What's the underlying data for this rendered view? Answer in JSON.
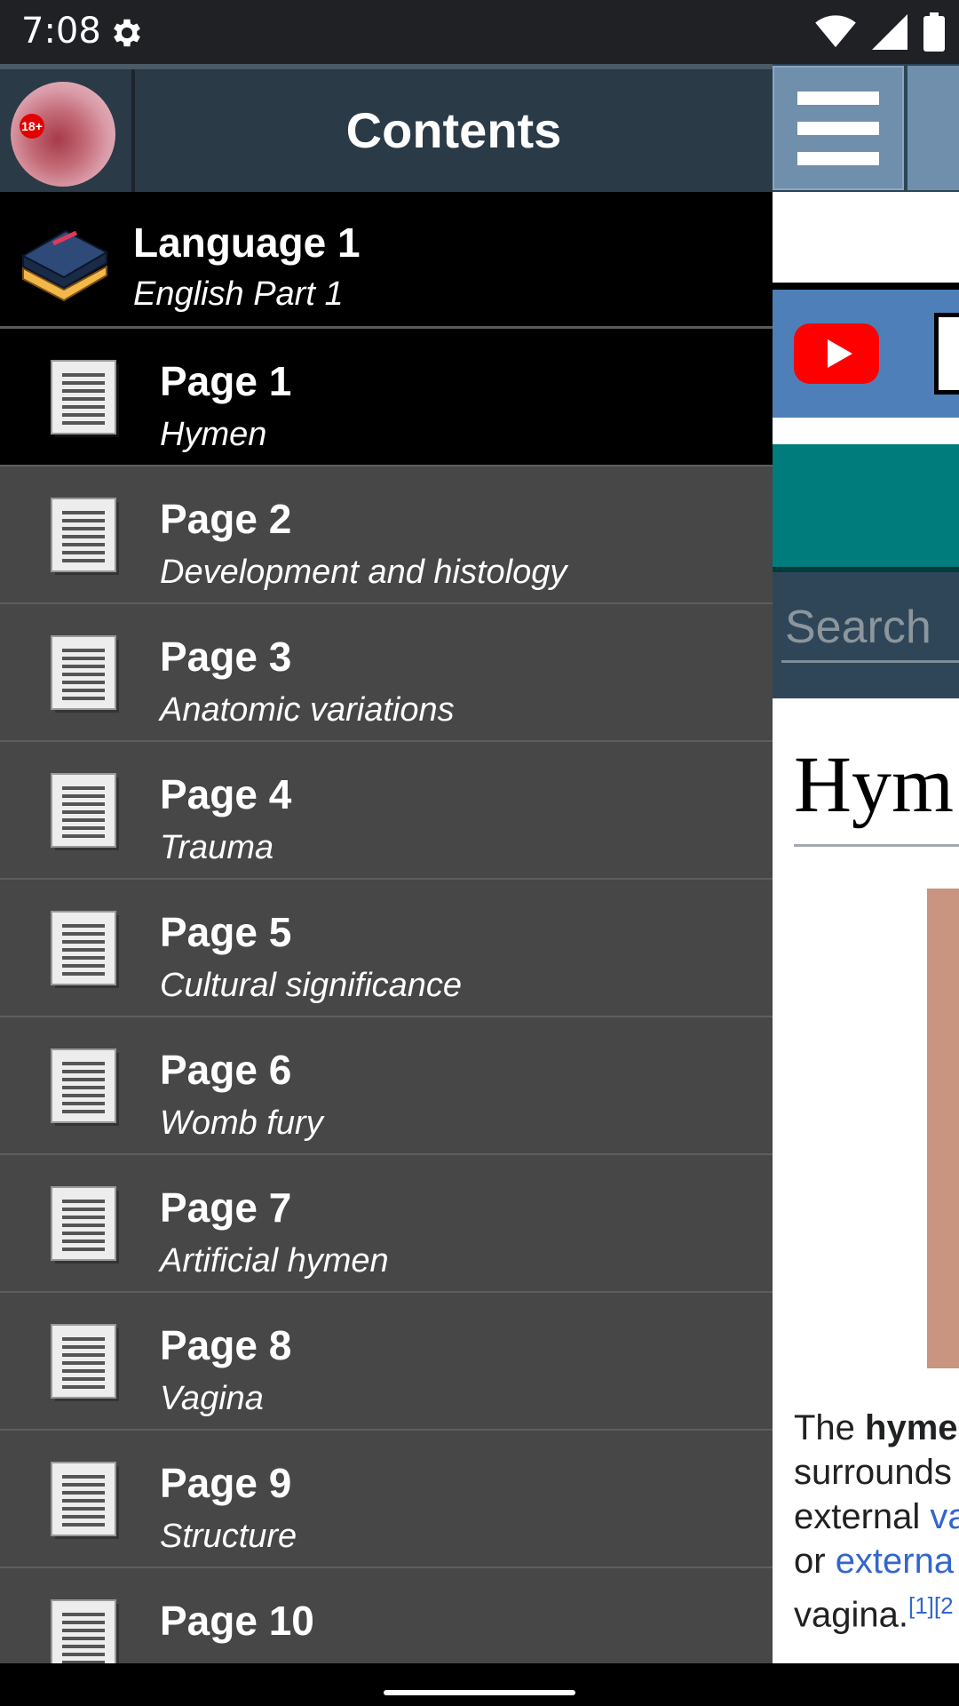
{
  "status_bar": {
    "time": "7:08",
    "icons": [
      "gear-icon",
      "wifi-icon",
      "signal-icon",
      "battery-icon"
    ]
  },
  "drawer": {
    "title": "Contents",
    "avatar_badge": "18+",
    "section": {
      "title": "Language 1",
      "subtitle": "English Part 1",
      "icon": "book-stack-icon"
    },
    "pages": [
      {
        "title": "Page 1",
        "subtitle": "Hymen"
      },
      {
        "title": "Page 2",
        "subtitle": "Development and histology"
      },
      {
        "title": "Page 3",
        "subtitle": "Anatomic variations"
      },
      {
        "title": "Page 4",
        "subtitle": "Trauma"
      },
      {
        "title": "Page 5",
        "subtitle": "Cultural significance"
      },
      {
        "title": "Page 6",
        "subtitle": "Womb fury"
      },
      {
        "title": "Page 7",
        "subtitle": "Artificial hymen"
      },
      {
        "title": "Page 8",
        "subtitle": "Vagina"
      },
      {
        "title": "Page 9",
        "subtitle": "Structure"
      },
      {
        "title": "Page 10",
        "subtitle": ""
      }
    ],
    "active_index": 0
  },
  "webview": {
    "search_placeholder": "Search",
    "article_title": "Hym",
    "text_lines": {
      "l1_pre": "The ",
      "l1_bold": "hyme",
      "l2": "surrounds",
      "l3_pre": "external ",
      "l3_link": "va",
      "l4_pre": "or ",
      "l4_link": "externa",
      "l5": "vagina.",
      "l5_ref": "[1][2"
    }
  },
  "colors": {
    "drawer_bg": "#474747",
    "header_bg": "#2b3a47",
    "active_row": "#000000",
    "teal": "#007c7c",
    "link": "#3366cc"
  }
}
